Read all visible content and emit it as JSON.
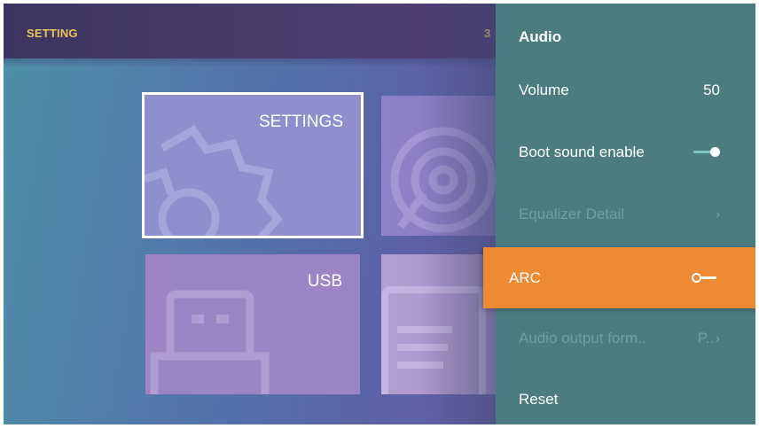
{
  "topbar": {
    "title": "SETTING",
    "clock": "3"
  },
  "tiles": {
    "settings": {
      "label": "SETTINGS",
      "icon": "gear-icon"
    },
    "media": {
      "label": "",
      "icon": "disc-icon"
    },
    "usb": {
      "label": "USB",
      "icon": "usb-icon"
    },
    "doc": {
      "label": "",
      "icon": "document-icon"
    }
  },
  "panel": {
    "title": "Audio",
    "volume": {
      "label": "Volume",
      "value": "50"
    },
    "boot_sound": {
      "label": "Boot sound enable",
      "enabled": true
    },
    "equalizer": {
      "label": "Equalizer Detail",
      "chevron": "›"
    },
    "arc": {
      "label": "ARC",
      "enabled": false
    },
    "audio_output": {
      "label": "Audio output form..",
      "value": "P..",
      "chevron": "›"
    },
    "reset": {
      "label": "Reset"
    }
  },
  "colors": {
    "accent": "#ee8a34",
    "panel_bg": "#4b7c80",
    "topbar_text": "#e8c35a",
    "disabled_text": "#6f9fa2"
  }
}
